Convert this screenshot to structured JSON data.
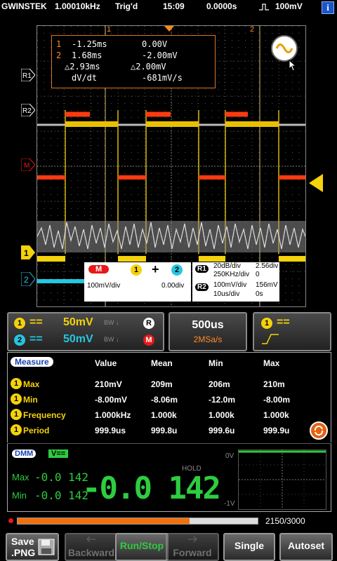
{
  "status": {
    "brand": "GWINSTEK",
    "frequency": "1.00010kHz",
    "trigger_state": "Trig'd",
    "time": "15:09",
    "offset": "0.0000s",
    "trigger_level": "100mV",
    "info_label": "i"
  },
  "scope": {
    "cursor_markers": [
      "1",
      "2"
    ],
    "channel_markers": [
      "R1",
      "R2",
      "M",
      "1",
      "2"
    ],
    "cursor_readout": {
      "row1": {
        "idx": "1",
        "time": "-1.25ms",
        "volt": "0.00V"
      },
      "row2": {
        "idx": "2",
        "time": "1.68ms",
        "volt": "-2.00mV"
      },
      "row3": {
        "time": "△2.93ms",
        "volt": "△2.00mV"
      },
      "row4": {
        "label": "dV/dt",
        "value": "-681mV/s"
      }
    },
    "math": {
      "label": "M",
      "scale": "100mV/div",
      "ch1": "1",
      "op": "+",
      "ch2": "2",
      "offset": "0.00div"
    },
    "ref1": {
      "label": "R1",
      "scale": "20dB/div",
      "pos": "2.56div",
      "freq": "250KHz/div",
      "offset": "0"
    },
    "ref2": {
      "label": "R2",
      "scale": "100mV/div",
      "pos": "156mV",
      "time": "10us/div",
      "offset": "0s"
    }
  },
  "channels": {
    "ch1": {
      "label": "1",
      "coupling": "==",
      "scale": "50mV",
      "bw": "BW ↓"
    },
    "ch2": {
      "label": "2",
      "coupling": "==",
      "scale": "50mV",
      "bw": "BW ↓"
    },
    "ref_button": "R",
    "math_button": "M"
  },
  "timebase": {
    "value": "500us",
    "sample_rate": "2MSa/s"
  },
  "trigger": {
    "source": "1",
    "coupling": "=="
  },
  "measure": {
    "title": "Measure",
    "headers": [
      "Value",
      "Mean",
      "Min",
      "Max"
    ],
    "rows": [
      {
        "ch": "1",
        "name": "Max",
        "value": "210mV",
        "mean": "209m",
        "min": "206m",
        "max": "210m"
      },
      {
        "ch": "1",
        "name": "Min",
        "value": "-8.00mV",
        "mean": "-8.06m",
        "min": "-12.0m",
        "max": "-8.00m"
      },
      {
        "ch": "1",
        "name": "Frequency",
        "value": "1.000kHz",
        "mean": "1.000k",
        "min": "1.000k",
        "max": "1.000k"
      },
      {
        "ch": "1",
        "name": "Period",
        "value": "999.9us",
        "mean": "999.8u",
        "min": "999.6u",
        "max": "999.9u"
      }
    ]
  },
  "dmm": {
    "title": "DMM",
    "mode": "V==",
    "max_label": "Max",
    "max_value": "-0.0 142",
    "min_label": "Min",
    "min_value": "-0.0 142",
    "hold": "HOLD",
    "reading": "-0.0 142",
    "trend_top": "0V",
    "trend_bottom": "-1V"
  },
  "record": {
    "counter": "2150/3000",
    "progress": 0.7167
  },
  "buttons": {
    "save_line1": "Save",
    "save_line2": ".PNG",
    "backward": "Backward",
    "run_stop": "Run/Stop",
    "forward": "Forward",
    "single": "Single",
    "autoset": "Autoset"
  },
  "colors": {
    "ch1": "#f4d20c",
    "ch2": "#26c6e0",
    "math": "#e81818",
    "ref": "#c0c0c0",
    "accent": "#f07010"
  }
}
